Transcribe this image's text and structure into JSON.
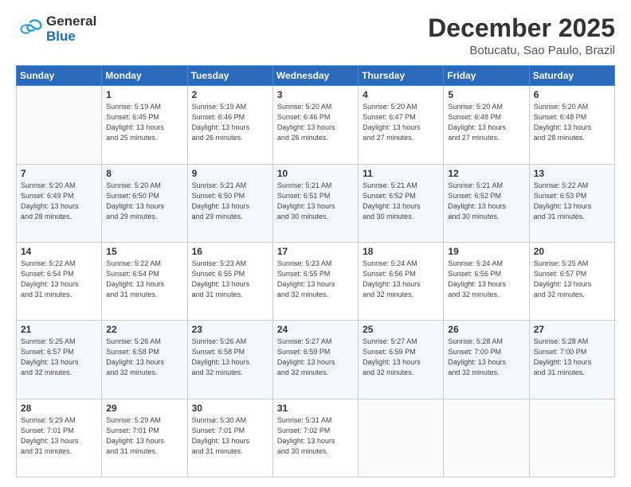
{
  "logo": {
    "general": "General",
    "blue": "Blue"
  },
  "header": {
    "month": "December 2025",
    "location": "Botucatu, Sao Paulo, Brazil"
  },
  "days_of_week": [
    "Sunday",
    "Monday",
    "Tuesday",
    "Wednesday",
    "Thursday",
    "Friday",
    "Saturday"
  ],
  "weeks": [
    [
      {
        "day": "",
        "info": ""
      },
      {
        "day": "1",
        "info": "Sunrise: 5:19 AM\nSunset: 6:45 PM\nDaylight: 13 hours\nand 25 minutes."
      },
      {
        "day": "2",
        "info": "Sunrise: 5:19 AM\nSunset: 6:46 PM\nDaylight: 13 hours\nand 26 minutes."
      },
      {
        "day": "3",
        "info": "Sunrise: 5:20 AM\nSunset: 6:46 PM\nDaylight: 13 hours\nand 26 minutes."
      },
      {
        "day": "4",
        "info": "Sunrise: 5:20 AM\nSunset: 6:47 PM\nDaylight: 13 hours\nand 27 minutes."
      },
      {
        "day": "5",
        "info": "Sunrise: 5:20 AM\nSunset: 6:48 PM\nDaylight: 13 hours\nand 27 minutes."
      },
      {
        "day": "6",
        "info": "Sunrise: 5:20 AM\nSunset: 6:48 PM\nDaylight: 13 hours\nand 28 minutes."
      }
    ],
    [
      {
        "day": "7",
        "info": "Sunrise: 5:20 AM\nSunset: 6:49 PM\nDaylight: 13 hours\nand 28 minutes."
      },
      {
        "day": "8",
        "info": "Sunrise: 5:20 AM\nSunset: 6:50 PM\nDaylight: 13 hours\nand 29 minutes."
      },
      {
        "day": "9",
        "info": "Sunrise: 5:21 AM\nSunset: 6:50 PM\nDaylight: 13 hours\nand 29 minutes."
      },
      {
        "day": "10",
        "info": "Sunrise: 5:21 AM\nSunset: 6:51 PM\nDaylight: 13 hours\nand 30 minutes."
      },
      {
        "day": "11",
        "info": "Sunrise: 5:21 AM\nSunset: 6:52 PM\nDaylight: 13 hours\nand 30 minutes."
      },
      {
        "day": "12",
        "info": "Sunrise: 5:21 AM\nSunset: 6:52 PM\nDaylight: 13 hours\nand 30 minutes."
      },
      {
        "day": "13",
        "info": "Sunrise: 5:22 AM\nSunset: 6:53 PM\nDaylight: 13 hours\nand 31 minutes."
      }
    ],
    [
      {
        "day": "14",
        "info": "Sunrise: 5:22 AM\nSunset: 6:54 PM\nDaylight: 13 hours\nand 31 minutes."
      },
      {
        "day": "15",
        "info": "Sunrise: 5:22 AM\nSunset: 6:54 PM\nDaylight: 13 hours\nand 31 minutes."
      },
      {
        "day": "16",
        "info": "Sunrise: 5:23 AM\nSunset: 6:55 PM\nDaylight: 13 hours\nand 31 minutes."
      },
      {
        "day": "17",
        "info": "Sunrise: 5:23 AM\nSunset: 6:55 PM\nDaylight: 13 hours\nand 32 minutes."
      },
      {
        "day": "18",
        "info": "Sunrise: 5:24 AM\nSunset: 6:56 PM\nDaylight: 13 hours\nand 32 minutes."
      },
      {
        "day": "19",
        "info": "Sunrise: 5:24 AM\nSunset: 6:56 PM\nDaylight: 13 hours\nand 32 minutes."
      },
      {
        "day": "20",
        "info": "Sunrise: 5:25 AM\nSunset: 6:57 PM\nDaylight: 13 hours\nand 32 minutes."
      }
    ],
    [
      {
        "day": "21",
        "info": "Sunrise: 5:25 AM\nSunset: 6:57 PM\nDaylight: 13 hours\nand 32 minutes."
      },
      {
        "day": "22",
        "info": "Sunrise: 5:26 AM\nSunset: 6:58 PM\nDaylight: 13 hours\nand 32 minutes."
      },
      {
        "day": "23",
        "info": "Sunrise: 5:26 AM\nSunset: 6:58 PM\nDaylight: 13 hours\nand 32 minutes."
      },
      {
        "day": "24",
        "info": "Sunrise: 5:27 AM\nSunset: 6:59 PM\nDaylight: 13 hours\nand 32 minutes."
      },
      {
        "day": "25",
        "info": "Sunrise: 5:27 AM\nSunset: 6:59 PM\nDaylight: 13 hours\nand 32 minutes."
      },
      {
        "day": "26",
        "info": "Sunrise: 5:28 AM\nSunset: 7:00 PM\nDaylight: 13 hours\nand 32 minutes."
      },
      {
        "day": "27",
        "info": "Sunrise: 5:28 AM\nSunset: 7:00 PM\nDaylight: 13 hours\nand 31 minutes."
      }
    ],
    [
      {
        "day": "28",
        "info": "Sunrise: 5:29 AM\nSunset: 7:01 PM\nDaylight: 13 hours\nand 31 minutes."
      },
      {
        "day": "29",
        "info": "Sunrise: 5:29 AM\nSunset: 7:01 PM\nDaylight: 13 hours\nand 31 minutes."
      },
      {
        "day": "30",
        "info": "Sunrise: 5:30 AM\nSunset: 7:01 PM\nDaylight: 13 hours\nand 31 minutes."
      },
      {
        "day": "31",
        "info": "Sunrise: 5:31 AM\nSunset: 7:02 PM\nDaylight: 13 hours\nand 30 minutes."
      },
      {
        "day": "",
        "info": ""
      },
      {
        "day": "",
        "info": ""
      },
      {
        "day": "",
        "info": ""
      }
    ]
  ]
}
